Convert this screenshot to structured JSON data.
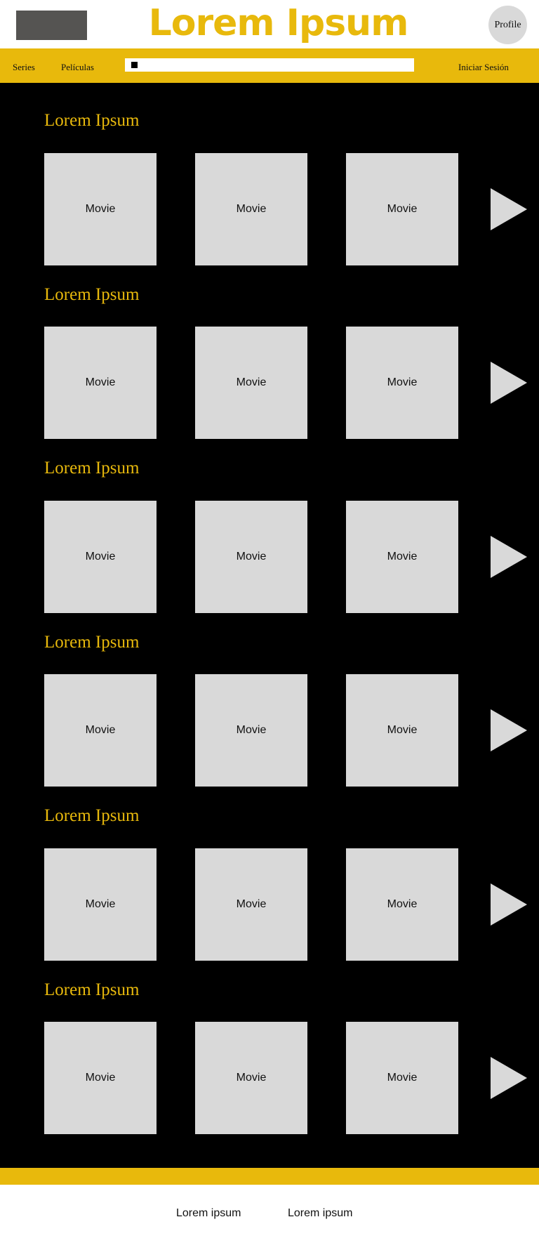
{
  "header": {
    "title": "Lorem Ipsum",
    "profile_label": "Profile"
  },
  "nav": {
    "series_label": "Series",
    "movies_label": "Películas",
    "login_label": "Iniciar Sesión"
  },
  "sections": [
    {
      "title": "Lorem Ipsum",
      "tiles": [
        "Movie",
        "Movie",
        "Movie"
      ]
    },
    {
      "title": "Lorem Ipsum",
      "tiles": [
        "Movie",
        "Movie",
        "Movie"
      ]
    },
    {
      "title": "Lorem Ipsum",
      "tiles": [
        "Movie",
        "Movie",
        "Movie"
      ]
    },
    {
      "title": "Lorem Ipsum",
      "tiles": [
        "Movie",
        "Movie",
        "Movie"
      ]
    },
    {
      "title": "Lorem Ipsum",
      "tiles": [
        "Movie",
        "Movie",
        "Movie"
      ]
    },
    {
      "title": "Lorem Ipsum",
      "tiles": [
        "Movie",
        "Movie",
        "Movie"
      ]
    }
  ],
  "footer": {
    "links": [
      "Lorem ipsum",
      "Lorem ipsum"
    ]
  },
  "colors": {
    "accent": "#e8b90c",
    "background": "#000000",
    "tile": "#d9d9d9",
    "logo_placeholder": "#555452"
  }
}
